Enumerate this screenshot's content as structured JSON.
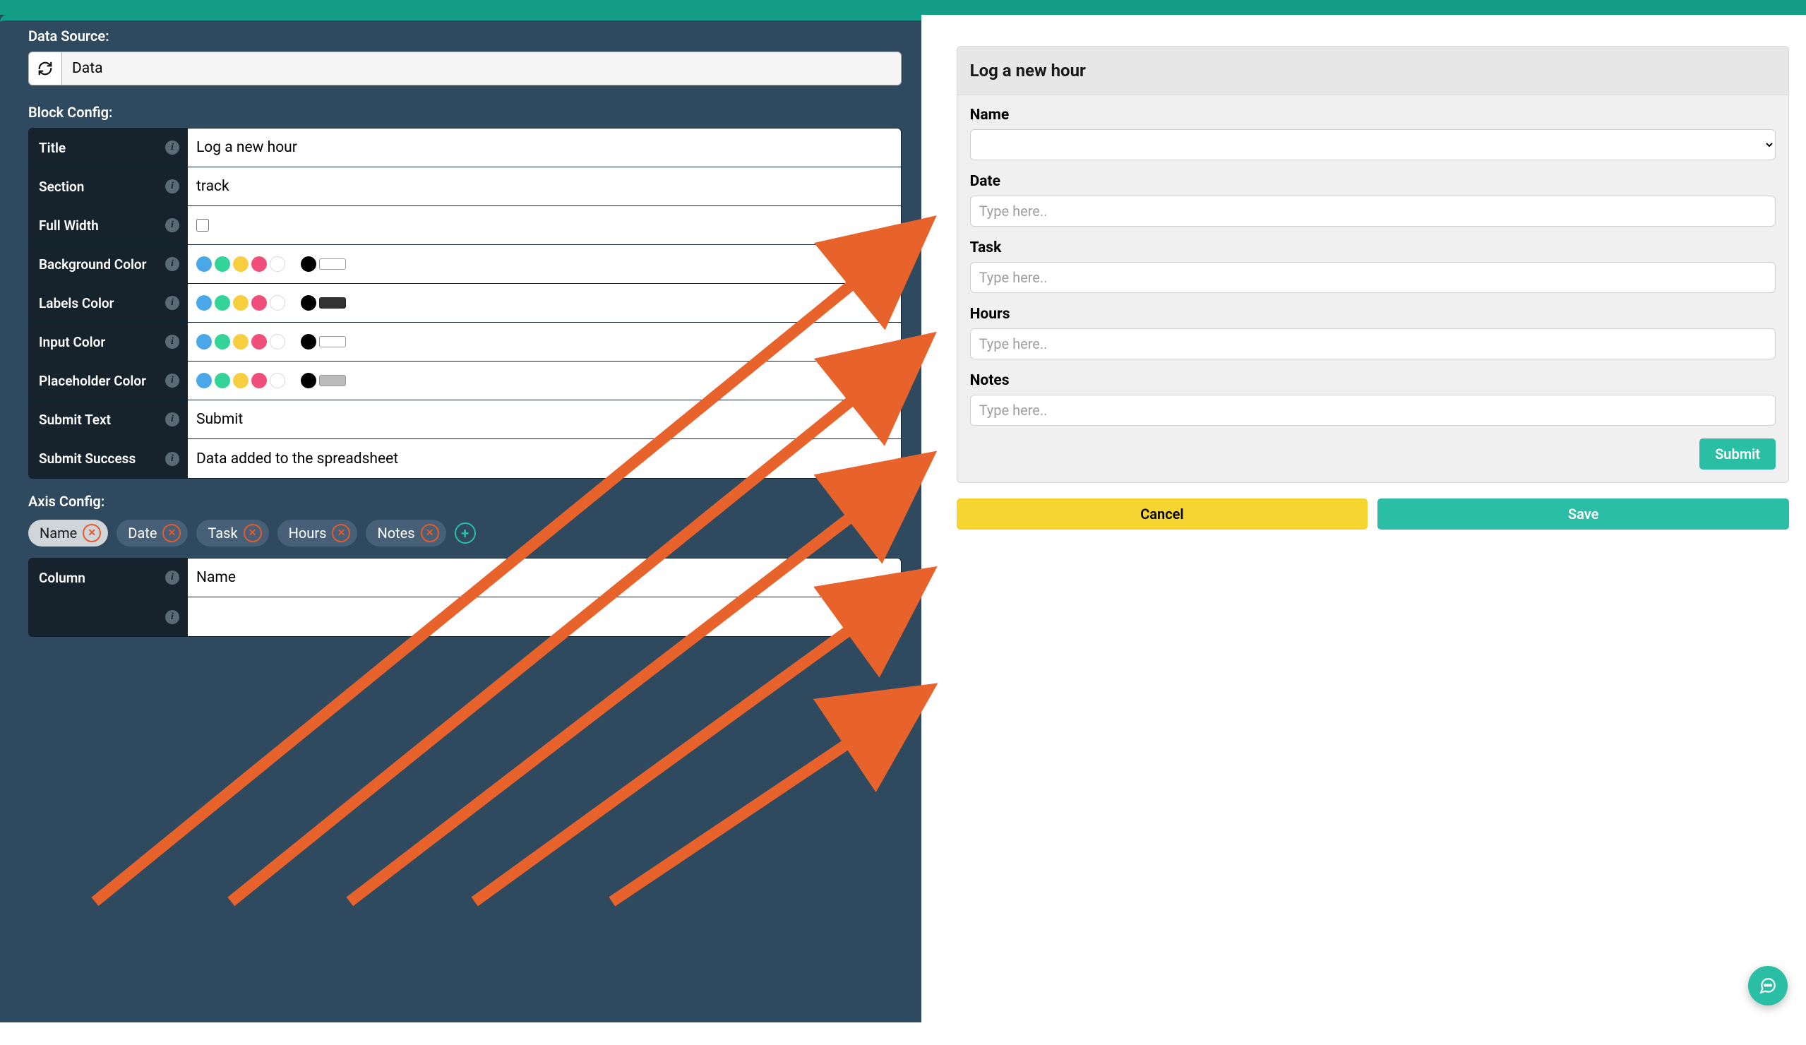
{
  "data_source": {
    "label": "Data Source:",
    "value": "Data"
  },
  "block_config": {
    "label": "Block Config:",
    "title": {
      "label": "Title",
      "value": "Log a new hour"
    },
    "section": {
      "label": "Section",
      "value": "track"
    },
    "full_width": {
      "label": "Full Width",
      "checked": false
    },
    "bg_color": {
      "label": "Background Color"
    },
    "labels_color": {
      "label": "Labels Color"
    },
    "input_color": {
      "label": "Input Color"
    },
    "placeholder_color": {
      "label": "Placeholder Color"
    },
    "submit_text": {
      "label": "Submit Text",
      "value": "Submit"
    },
    "submit_success": {
      "label": "Submit Success",
      "value": "Data added to the spreadsheet"
    }
  },
  "axis_config": {
    "label": "Axis Config:",
    "chips": [
      "Name",
      "Date",
      "Task",
      "Hours",
      "Notes"
    ],
    "active_index": 0,
    "column": {
      "label": "Column",
      "value": "Name"
    }
  },
  "preview": {
    "title": "Log a new hour",
    "fields": [
      {
        "label": "Name",
        "type": "select",
        "placeholder": ""
      },
      {
        "label": "Date",
        "type": "text",
        "placeholder": "Type here.."
      },
      {
        "label": "Task",
        "type": "text",
        "placeholder": "Type here.."
      },
      {
        "label": "Hours",
        "type": "text",
        "placeholder": "Type here.."
      },
      {
        "label": "Notes",
        "type": "text",
        "placeholder": "Type here.."
      }
    ],
    "submit_label": "Submit",
    "cancel_label": "Cancel",
    "save_label": "Save"
  },
  "colors": {
    "accent": "#2abfa4",
    "warn": "#f7d531",
    "arrow": "#e8622b"
  }
}
